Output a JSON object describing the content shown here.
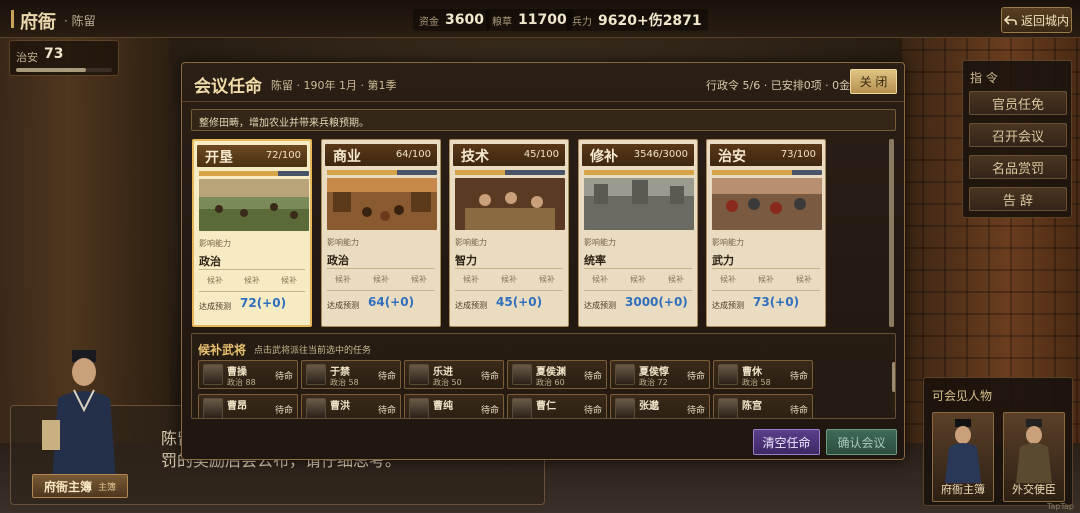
{
  "topbar": {
    "title": "府衙",
    "city": "· 陈留",
    "resources": [
      {
        "label": "资金",
        "value": "3600"
      },
      {
        "label": "粮草",
        "value": "11700"
      },
      {
        "label": "兵力",
        "value": "9620+伤2871"
      }
    ],
    "return_label": "返回城内"
  },
  "stability": {
    "label": "治安",
    "value": "73",
    "level": 0.73
  },
  "command_panel": {
    "title": "指 令",
    "buttons": [
      "官员任免",
      "召开会议",
      "名品赏罚",
      "告 辞"
    ]
  },
  "dialog": {
    "line1": "陈留",
    "line2": "罚的奖励后会公布，请仔细思考。"
  },
  "speaker": {
    "name": "府衙主簿",
    "role": "主簿"
  },
  "visitors": {
    "title": "可会见人物",
    "people": [
      "府衙主簿",
      "外交使臣"
    ]
  },
  "watermark": "TapTap",
  "modal": {
    "title": "会议任命",
    "subtitle": "陈留 · 190年 1月 · 第1季",
    "status": "行政令 5/6 · 已安排0项 · 0金",
    "close_label": "关 闭",
    "hint": "整修田畴，增加农业并带来兵粮预期。",
    "tasks": [
      {
        "name": "开垦",
        "progress": "72/100",
        "fill": 0.72,
        "ability_label": "影响能力",
        "ability": "政治",
        "slots": [
          "候补",
          "候补",
          "候补"
        ],
        "pred_label": "达成预测",
        "pred": "72(+0)",
        "selected": true
      },
      {
        "name": "商业",
        "progress": "64/100",
        "fill": 0.64,
        "ability_label": "影响能力",
        "ability": "政治",
        "slots": [
          "候补",
          "候补",
          "候补"
        ],
        "pred_label": "达成预测",
        "pred": "64(+0)",
        "selected": false
      },
      {
        "name": "技术",
        "progress": "45/100",
        "fill": 0.45,
        "ability_label": "影响能力",
        "ability": "智力",
        "slots": [
          "候补",
          "候补",
          "候补"
        ],
        "pred_label": "达成预测",
        "pred": "45(+0)",
        "selected": false
      },
      {
        "name": "修补",
        "progress": "3546/3000",
        "fill": 1.0,
        "ability_label": "影响能力",
        "ability": "统率",
        "slots": [
          "候补",
          "候补",
          "候补"
        ],
        "pred_label": "达成预测",
        "pred": "3000(+0)",
        "selected": false
      },
      {
        "name": "治安",
        "progress": "73/100",
        "fill": 0.73,
        "ability_label": "影响能力",
        "ability": "武力",
        "slots": [
          "候补",
          "候补",
          "候补"
        ],
        "pred_label": "达成预测",
        "pred": "73(+0)",
        "selected": false
      }
    ],
    "candidates_title": "候补武将",
    "candidates_hint": "点击武将派往当前选中的任务",
    "generals_row1": [
      {
        "name": "曹操",
        "stat": "政治 88",
        "status": "待命"
      },
      {
        "name": "于禁",
        "stat": "政治 58",
        "status": "待命"
      },
      {
        "name": "乐进",
        "stat": "政治 50",
        "status": "待命"
      },
      {
        "name": "夏侯渊",
        "stat": "政治 60",
        "status": "待命"
      },
      {
        "name": "夏侯惇",
        "stat": "政治 72",
        "status": "待命"
      },
      {
        "name": "曹休",
        "stat": "政治 58",
        "status": "待命"
      }
    ],
    "generals_row2": [
      {
        "name": "曹昂",
        "status": "待命"
      },
      {
        "name": "曹洪",
        "status": "待命"
      },
      {
        "name": "曹纯",
        "status": "待命"
      },
      {
        "name": "曹仁",
        "status": "待命"
      },
      {
        "name": "张邈",
        "status": "待命"
      },
      {
        "name": "陈宫",
        "status": "待命"
      }
    ],
    "clear_label": "清空任命",
    "confirm_label": "确认会议"
  }
}
